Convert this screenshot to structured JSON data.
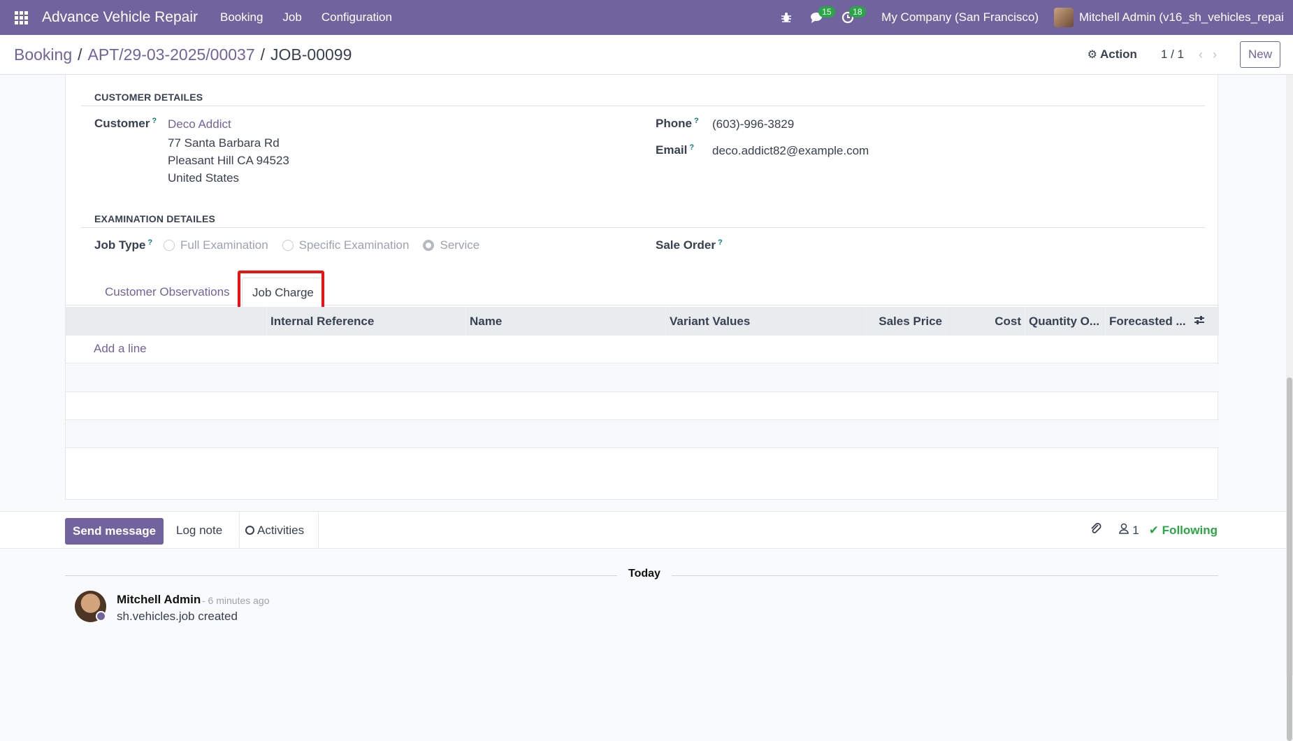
{
  "navbar": {
    "brand": "Advance Vehicle Repair",
    "menu": [
      "Booking",
      "Job",
      "Configuration"
    ],
    "messages_count": "15",
    "activities_count": "18",
    "company": "My Company (San Francisco)",
    "user": "Mitchell Admin (v16_sh_vehicles_repai..."
  },
  "control_panel": {
    "breadcrumb": [
      "Booking",
      "APT/29-03-2025/00037",
      "JOB-00099"
    ],
    "action_label": "Action",
    "pager": "1 / 1",
    "new_label": "New"
  },
  "customer_section": {
    "title": "CUSTOMER DETAILES",
    "customer_label": "Customer",
    "customer_name": "Deco Addict",
    "address": [
      "77 Santa Barbara Rd",
      "Pleasant Hill CA 94523",
      "United States"
    ],
    "phone_label": "Phone",
    "phone": "(603)-996-3829",
    "email_label": "Email",
    "email": "deco.addict82@example.com"
  },
  "examination_section": {
    "title": "EXAMINATION DETAILES",
    "job_type_label": "Job Type",
    "job_type_options": [
      "Full Examination",
      "Specific Examination",
      "Service"
    ],
    "job_type_selected": "Service",
    "sale_order_label": "Sale Order"
  },
  "tabs": [
    "Customer Observations",
    "Job Charge"
  ],
  "active_tab": "Job Charge",
  "table": {
    "columns": [
      "Internal Reference",
      "Name",
      "Variant Values",
      "Sales Price",
      "Cost",
      "Quantity O...",
      "Forecasted ..."
    ],
    "add_line": "Add a line"
  },
  "chatter": {
    "send_message": "Send message",
    "log_note": "Log note",
    "activities": "Activities",
    "followers_count": "1",
    "following": "Following",
    "today": "Today",
    "message": {
      "author": "Mitchell Admin",
      "time": "- 6 minutes ago",
      "body": "sh.vehicles.job created"
    }
  },
  "colors": {
    "brand": "#71639e",
    "highlight": "#ef1010",
    "success": "#28a745"
  }
}
